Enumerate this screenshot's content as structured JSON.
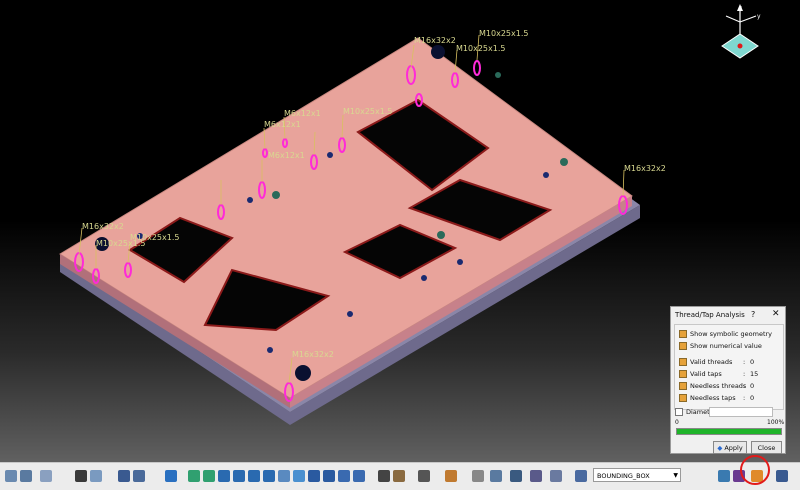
{
  "viewport": {
    "thread_labels": [
      "M16x32x2",
      "M10x25x1.5",
      "M10x25x1.5",
      "M6x12x1",
      "M6x12x1",
      "M6x12x1",
      "M10x25x1.5",
      "M16x32x2",
      "M10x25x1.5",
      "M16x32x2",
      "M10x25x1.5",
      "M16x32x2"
    ]
  },
  "compass": {
    "axis_z": "z",
    "axis_y": "y"
  },
  "dialog": {
    "title": "Thread/Tap Analysis",
    "help": "?",
    "close": "✕",
    "options": [
      {
        "label": "Show symbolic geometry",
        "checked": true
      },
      {
        "label": "Show numerical value",
        "checked": true
      }
    ],
    "stats": [
      {
        "label": "Valid threads",
        "value": "0",
        "checked": true
      },
      {
        "label": "Valid taps",
        "value": "15",
        "checked": true
      },
      {
        "label": "Needless threads",
        "value": "0",
        "checked": true
      },
      {
        "label": "Needless taps",
        "value": "0",
        "checked": true
      }
    ],
    "diameter_label": "Diameter",
    "progress_min": "0",
    "progress_max": "100%",
    "progress": 1.0,
    "apply_label": "Apply",
    "close_label": "Close"
  },
  "toolbar": {
    "combo_value": "BOUNDING_BOX",
    "highlight_color": "#e21a1a"
  }
}
